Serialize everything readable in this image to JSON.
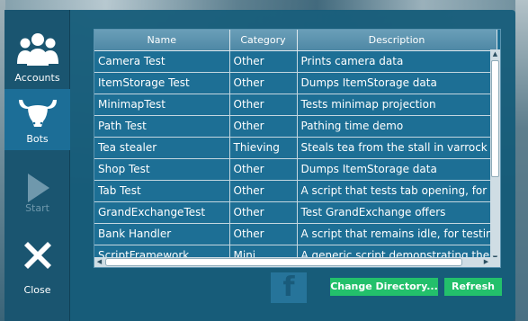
{
  "sidebar": {
    "items": [
      {
        "label": "Accounts",
        "icon": "users-icon"
      },
      {
        "label": "Bots",
        "icon": "bull-icon"
      },
      {
        "label": "Start",
        "icon": "play-icon"
      },
      {
        "label": "Close",
        "icon": "close-icon"
      }
    ]
  },
  "table": {
    "headers": [
      "Name",
      "Category",
      "Description"
    ],
    "rows": [
      [
        "Camera Test",
        "Other",
        "Prints camera data"
      ],
      [
        "ItemStorage Test",
        "Other",
        "Dumps ItemStorage data"
      ],
      [
        "MinimapTest",
        "Other",
        "Tests minimap projection"
      ],
      [
        "Path Test",
        "Other",
        "Pathing time demo"
      ],
      [
        "Tea stealer",
        "Thieving",
        "Steals tea from the stall in varrock"
      ],
      [
        "Shop Test",
        "Other",
        "Dumps ItemStorage data"
      ],
      [
        "Tab Test",
        "Other",
        "A script that tests tab opening, for testi"
      ],
      [
        "GrandExchangeTest",
        "Other",
        "Test GrandExchange offers"
      ],
      [
        "Bank Handler",
        "Other",
        "A script that remains idle, for testing ev"
      ],
      [
        "ScriptFramework",
        "Mini",
        "A generic script demonstrating the f"
      ]
    ]
  },
  "buttons": {
    "change_directory": "Change Directory...",
    "refresh": "Refresh"
  },
  "colors": {
    "accent_green": "#23c06b",
    "panel_blue": "#1d6f95",
    "active_nav": "#1c6e97"
  }
}
